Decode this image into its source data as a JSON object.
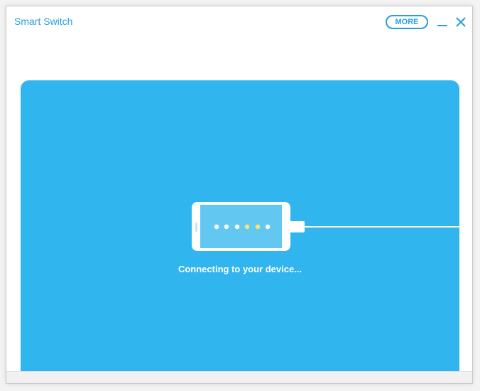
{
  "window": {
    "title": "Smart Switch"
  },
  "titlebar": {
    "more_label": "MORE"
  },
  "content": {
    "status": "Connecting to your device..."
  },
  "icons": {
    "minimize": "minimize-icon",
    "close": "close-icon",
    "phone": "phone-icon",
    "cable": "usb-cable-icon"
  },
  "colors": {
    "accent": "#2a9fd8",
    "panel": "#31b5ef",
    "screen": "#62c8f2",
    "dot_white": "#ffffff",
    "dot_yellow": "#ffe36e"
  }
}
